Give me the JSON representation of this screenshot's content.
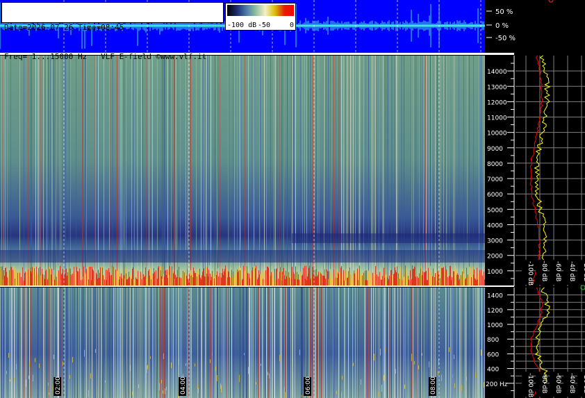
{
  "info": {
    "line1": "Date=2026-07-26 Time=08:45",
    "line2": "Freq= 1...15000 Hz   VLF E-field ©www.vlf.it"
  },
  "colorbar": {
    "labels": [
      "-100 dB",
      "-50",
      "0"
    ],
    "stops": [
      "#000000",
      "#1a2a6e",
      "#4a7aa8",
      "#8fc0a0",
      "#f4f0c8",
      "#d8c000",
      "#e02000",
      "#ff0000"
    ]
  },
  "waveform": {
    "labels": [
      "50 %",
      "0 %",
      "-50 %"
    ],
    "background": "#0000ff",
    "trace_color": "#40e0e0"
  },
  "chart_data": [
    {
      "type": "heatmap",
      "title": "",
      "ylabel": "Hz",
      "ylim": [
        0,
        15000
      ],
      "yticks": [
        1000,
        2000,
        3000,
        4000,
        5000,
        6000,
        7000,
        8000,
        9000,
        10000,
        11000,
        12000,
        13000,
        14000
      ],
      "x_time_labels": [
        "02:00",
        "04:00",
        "06:00",
        "08:00"
      ],
      "colormap_range_db": [
        -100,
        0
      ],
      "features": [
        {
          "band": "sferics broadband",
          "freq_range_hz": [
            0,
            15000
          ]
        },
        {
          "band": "strong low-frequency energy",
          "freq_range_hz": [
            0,
            600
          ]
        },
        {
          "band": "dark absorption band",
          "freq_range_hz": [
            1700,
            2200
          ]
        },
        {
          "band": "dark absorption band",
          "freq_range_hz": [
            3000,
            3400
          ]
        }
      ]
    },
    {
      "type": "heatmap",
      "ylabel": "Hz",
      "ylim": [
        0,
        1500
      ],
      "yticks": [
        200,
        400,
        600,
        800,
        1000,
        1200,
        1400
      ],
      "ytick_unit_label": "200 Hz",
      "x_time_labels": [
        "02:00",
        "04:00",
        "06:00",
        "08:00"
      ]
    },
    {
      "type": "line",
      "panel": "upper spectrum",
      "xlabel": "dB",
      "xticks": [
        "-100 dB",
        "-80 dB",
        "-60 dB",
        "-40 dB",
        "-20 dB"
      ],
      "series": [
        {
          "color": "#ffff00"
        },
        {
          "color": "#ff0000"
        }
      ]
    },
    {
      "type": "line",
      "panel": "lower spectrum",
      "xlabel": "dB",
      "xticks": [
        "-100 dB",
        "-80 dB",
        "-60 dB",
        "-40 dB",
        "-20 dB"
      ],
      "series": [
        {
          "color": "#ffff00"
        },
        {
          "color": "#ff0000"
        }
      ]
    }
  ]
}
